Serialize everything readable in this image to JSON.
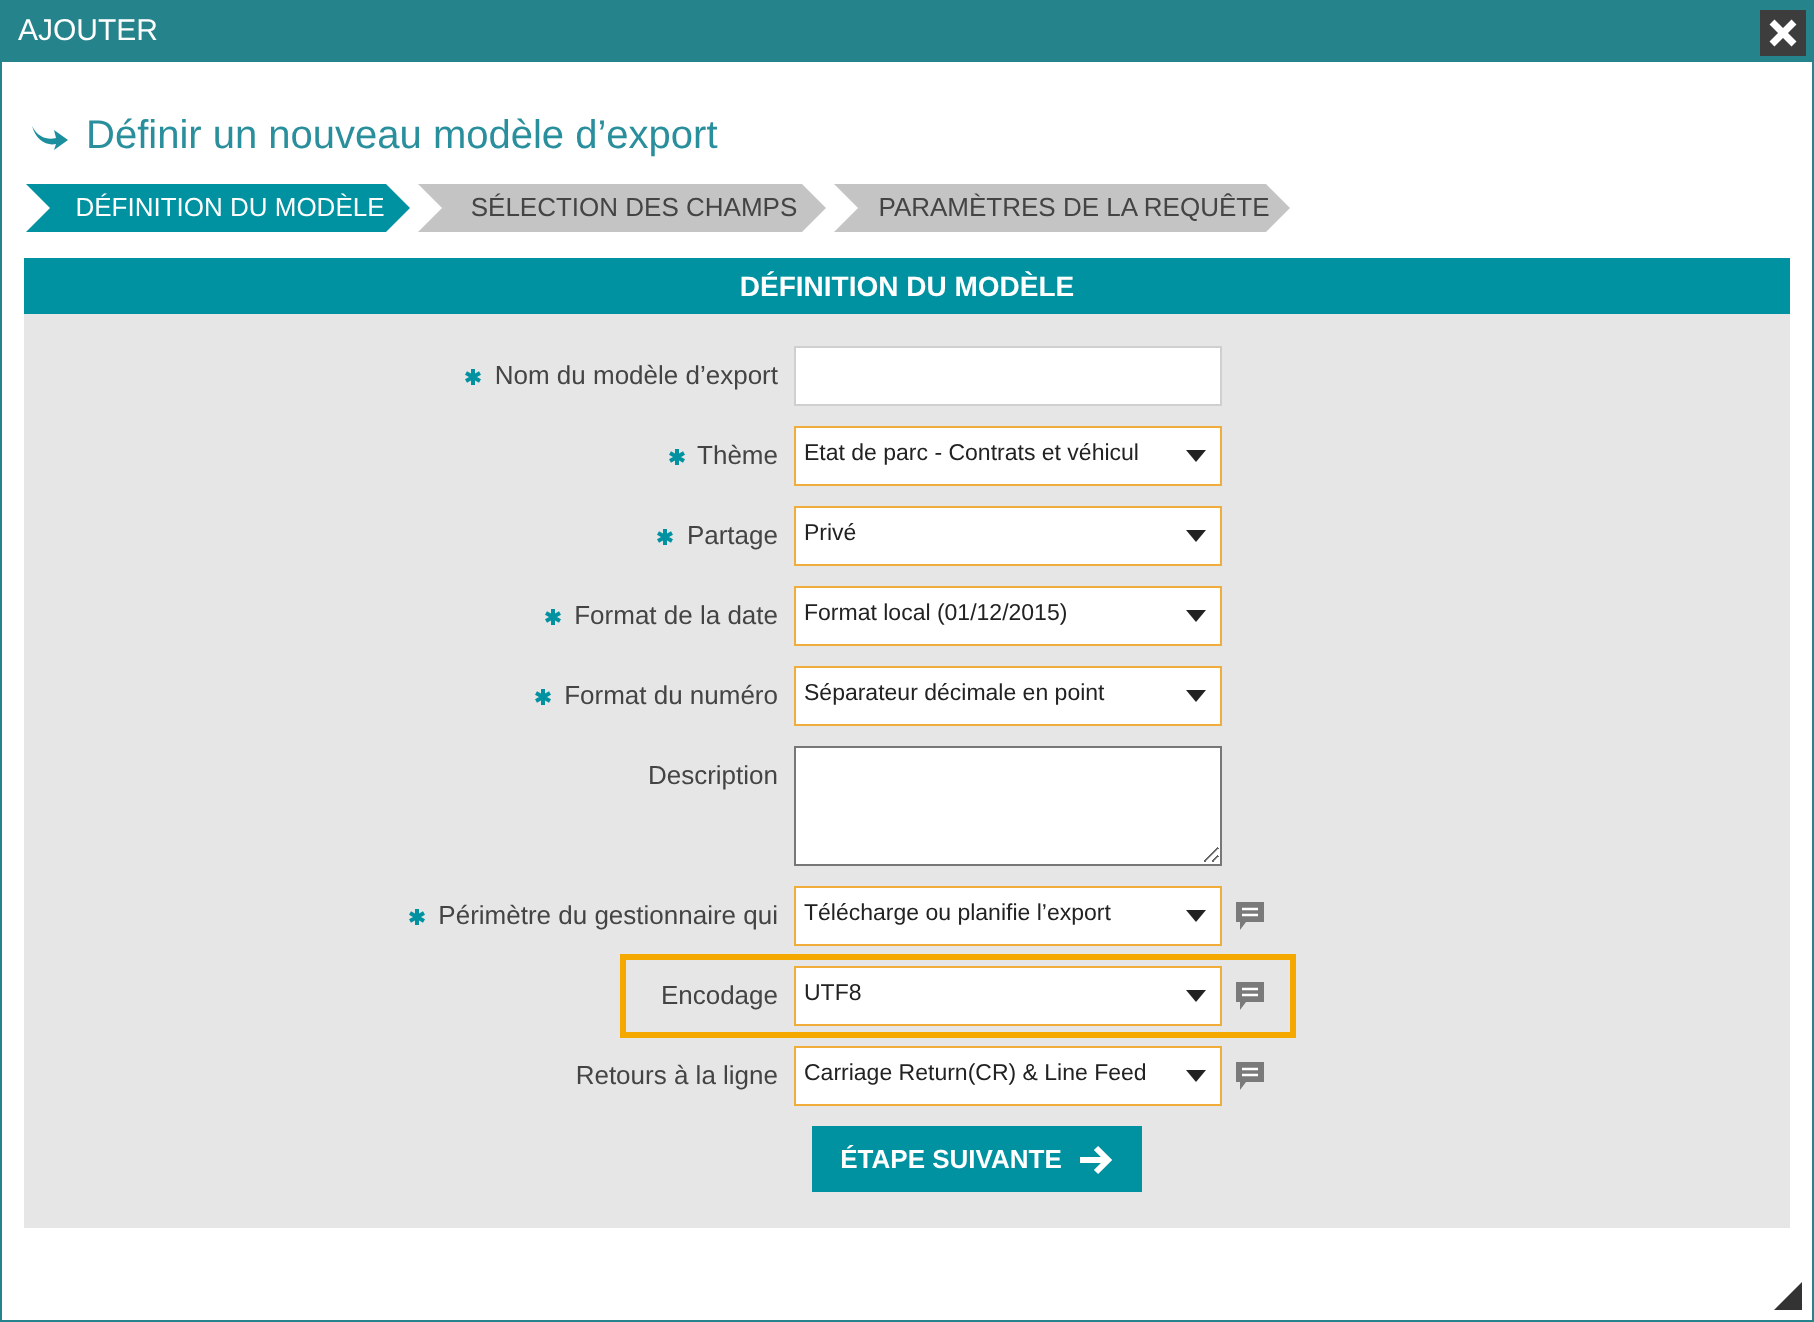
{
  "window": {
    "title": "AJOUTER"
  },
  "heading": "Définir un nouveau modèle d’export",
  "steps": [
    {
      "label": "DÉFINITION DU MODÈLE",
      "selected": true
    },
    {
      "label": "SÉLECTION DES CHAMPS",
      "selected": false
    },
    {
      "label": "PARAMÈTRES DE LA REQUÊTE",
      "selected": false
    }
  ],
  "panel": {
    "title": "DÉFINITION DU MODÈLE"
  },
  "fields": [
    {
      "kind": "text",
      "label": "Nom du modèle d’export",
      "required": true,
      "highlighted": false,
      "help": false
    },
    {
      "kind": "select",
      "label": "Thème",
      "value": "Etat de parc - Contrats et véhicul",
      "required": true,
      "highlighted": false,
      "help": false
    },
    {
      "kind": "select",
      "label": "Partage",
      "value": "Privé",
      "required": true,
      "highlighted": false,
      "help": false
    },
    {
      "kind": "select",
      "label": "Format de la date",
      "value": "Format local (01/12/2015)",
      "required": true,
      "highlighted": false,
      "help": false
    },
    {
      "kind": "select",
      "label": "Format du numéro",
      "value": "Séparateur décimale en point",
      "required": true,
      "highlighted": false,
      "help": false
    },
    {
      "kind": "textarea",
      "label": "Description",
      "required": false,
      "highlighted": false,
      "help": false
    },
    {
      "kind": "select",
      "label": "Périmètre du gestionnaire qui",
      "value": "Télécharge ou planifie l’export",
      "required": true,
      "highlighted": false,
      "help": true
    },
    {
      "kind": "select",
      "label": "Encodage",
      "value": "UTF8",
      "required": false,
      "highlighted": true,
      "help": true
    },
    {
      "kind": "select",
      "label": "Retours à la ligne",
      "value": "Carriage Return(CR) & Line Feed",
      "required": false,
      "highlighted": false,
      "help": true
    }
  ],
  "next_button": "ÉTAPE SUIVANTE"
}
